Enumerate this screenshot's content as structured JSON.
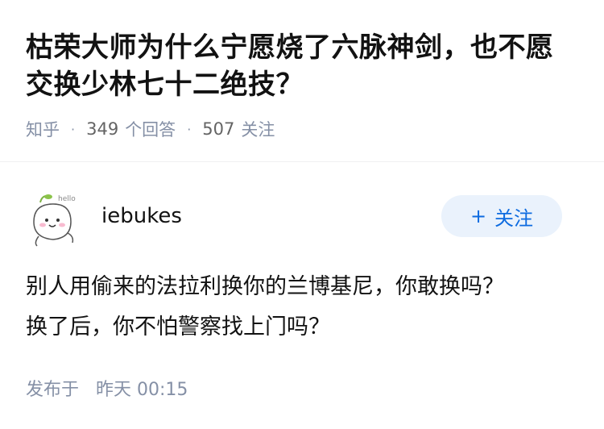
{
  "question": {
    "title": "枯荣大师为什么宁愿烧了六脉神剑，也不愿交换少林七十二绝技？",
    "source": "知乎",
    "answer_count": "349",
    "answer_label": "个回答",
    "follow_count": "507",
    "follow_label": "关注"
  },
  "answer": {
    "author": "iebukes",
    "follow_button": {
      "icon": "plus-icon",
      "label": "关注"
    },
    "avatar_text": "hello",
    "content": [
      "别人用偷来的法拉利换你的兰博基尼，你敢换吗？",
      "换了后，你不怕警察找上门吗？"
    ],
    "posted_label": "发布于",
    "posted_time": "昨天 00:15"
  },
  "colors": {
    "accent": "#0d6be0",
    "button_bg": "#eaf2fc",
    "meta": "#8590a6"
  }
}
